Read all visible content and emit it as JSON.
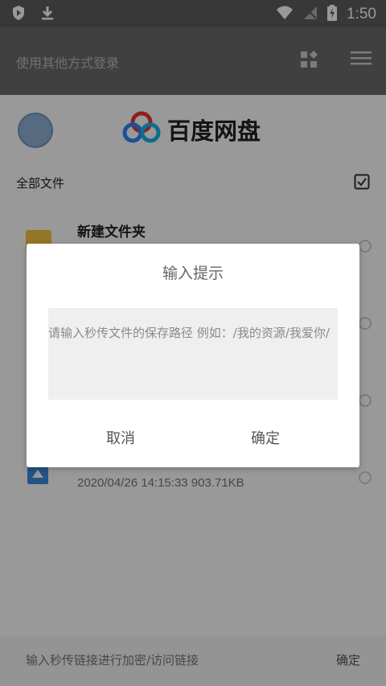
{
  "status_bar": {
    "time": "1:50",
    "icons": [
      "shield-icon",
      "download-icon",
      "wifi-icon",
      "signal-off-icon",
      "battery-icon"
    ]
  },
  "toolbar": {
    "title": "使用其他方式登录",
    "icons": [
      "apps-add-icon",
      "menu-icon"
    ]
  },
  "brand": {
    "name": "百度网盘"
  },
  "section": {
    "title": "全部文件"
  },
  "list": [
    {
      "title": "新建文件夹",
      "meta": ""
    },
    {
      "title": "",
      "meta": ""
    },
    {
      "title": "",
      "meta": ""
    },
    {
      "title": "",
      "meta": "2020/04/26 14:15:33    903.71KB"
    }
  ],
  "bottom": {
    "hint": "输入秒传链接进行加密/访问链接",
    "ok": "确定"
  },
  "dialog": {
    "title": "输入提示",
    "placeholder": "请输入秒传文件的保存路径 例如：/我的资源/我爱你/",
    "cancel": "取消",
    "ok": "确定"
  }
}
